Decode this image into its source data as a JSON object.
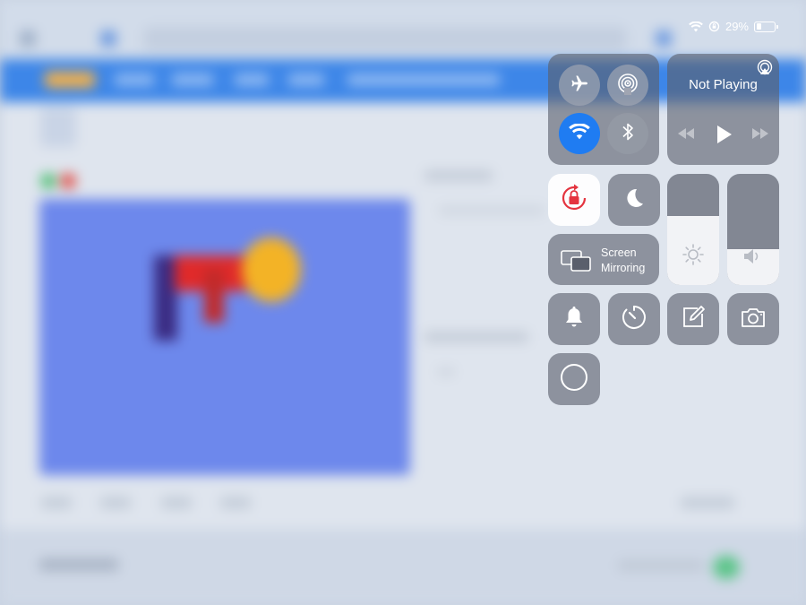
{
  "status_bar": {
    "battery_text": "29%",
    "battery_level": 0.29,
    "icons": [
      "wifi-icon",
      "orientation-lock-icon",
      "battery-icon"
    ]
  },
  "control_center": {
    "connectivity": {
      "airplane_mode": {
        "icon": "airplane-icon",
        "on": false
      },
      "airdrop": {
        "icon": "airdrop-icon",
        "on": false
      },
      "wifi": {
        "icon": "wifi-icon",
        "on": true
      },
      "bluetooth": {
        "icon": "bluetooth-icon",
        "on": false
      }
    },
    "music": {
      "status": "Not Playing",
      "icons": [
        "airplay-icon",
        "rewind-icon",
        "play-icon",
        "fast-forward-icon"
      ]
    },
    "orientation_lock": {
      "icon": "orientation-lock-icon",
      "on": true
    },
    "do_not_disturb": {
      "icon": "moon-icon",
      "on": false
    },
    "brightness": {
      "icon": "sun-icon",
      "level": 0.62
    },
    "volume": {
      "icon": "speaker-icon",
      "level": 0.32
    },
    "screen_mirroring": {
      "label_line1": "Screen",
      "label_line2": "Mirroring",
      "icon": "screen-mirroring-icon"
    },
    "shortcuts": [
      {
        "name": "bell",
        "icon": "bell-icon"
      },
      {
        "name": "timer",
        "icon": "timer-icon"
      },
      {
        "name": "notes",
        "icon": "notes-icon"
      },
      {
        "name": "camera",
        "icon": "camera-icon"
      },
      {
        "name": "screen-record",
        "icon": "record-icon"
      }
    ]
  },
  "colors": {
    "accent_blue": "#1f7cf2",
    "orientation_lock_red": "#e4343f",
    "module_dark": "#5a5f6c"
  }
}
